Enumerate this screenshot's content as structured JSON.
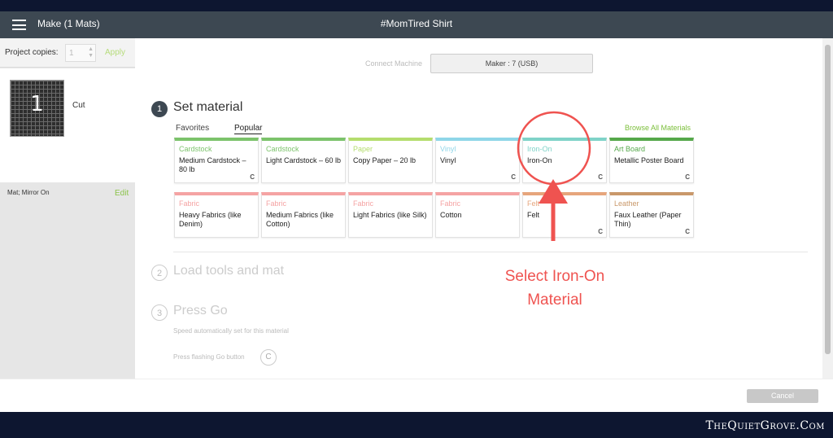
{
  "topbar": {
    "make_title": "Make (1 Mats)",
    "doc_title": "#MomTired Shirt"
  },
  "left": {
    "copies_label": "Project copies:",
    "copies_value": "1",
    "apply": "Apply",
    "mat_number": "1",
    "mat_cut": "Cut",
    "mat_info": "Mat; Mirror On",
    "edit": "Edit"
  },
  "machine": {
    "connect_label": "Connect Machine",
    "selected": "Maker : 7 (USB)"
  },
  "steps": [
    {
      "num": "1",
      "title": "Set material"
    },
    {
      "num": "2",
      "title": "Load tools and mat"
    },
    {
      "num": "3",
      "title": "Press Go"
    }
  ],
  "hints": {
    "speed": "Speed automatically set for this material",
    "press": "Press flashing Go button"
  },
  "tabs": {
    "favorites": "Favorites",
    "popular": "Popular",
    "browse": "Browse All Materials"
  },
  "materials": [
    {
      "cat": "Cardstock",
      "name": "Medium Cardstock – 80 lb",
      "color": "#7cc36b",
      "icon": "C"
    },
    {
      "cat": "Cardstock",
      "name": "Light Cardstock – 60 lb",
      "color": "#7cc36b",
      "icon": ""
    },
    {
      "cat": "Paper",
      "name": "Copy Paper – 20 lb",
      "color": "#b4dd6e",
      "icon": ""
    },
    {
      "cat": "Vinyl",
      "name": "Vinyl",
      "color": "#8fd6e8",
      "icon": "C"
    },
    {
      "cat": "Iron-On",
      "name": "Iron-On",
      "color": "#7fd3c8",
      "icon": "C"
    },
    {
      "cat": "Art Board",
      "name": "Metallic Poster Board",
      "color": "#55a84a",
      "icon": "C"
    },
    {
      "cat": "Fabric",
      "name": "Heavy Fabrics (like Denim)",
      "color": "#f5a3a3",
      "icon": ""
    },
    {
      "cat": "Fabric",
      "name": "Medium Fabrics (like Cotton)",
      "color": "#f5a3a3",
      "icon": ""
    },
    {
      "cat": "Fabric",
      "name": "Light Fabrics (like Silk)",
      "color": "#f5a3a3",
      "icon": ""
    },
    {
      "cat": "Fabric",
      "name": "Cotton",
      "color": "#f5a3a3",
      "icon": ""
    },
    {
      "cat": "Felt",
      "name": "Felt",
      "color": "#e6a57c",
      "icon": "C"
    },
    {
      "cat": "Leather",
      "name": "Faux Leather (Paper Thin)",
      "color": "#c9986a",
      "icon": "C"
    }
  ],
  "annotation": {
    "line1": "Select Iron-On",
    "line2": "Material",
    "color": "#ef5350"
  },
  "footer": {
    "cancel": "Cancel"
  },
  "brand": "TheQuietGrove.Com"
}
